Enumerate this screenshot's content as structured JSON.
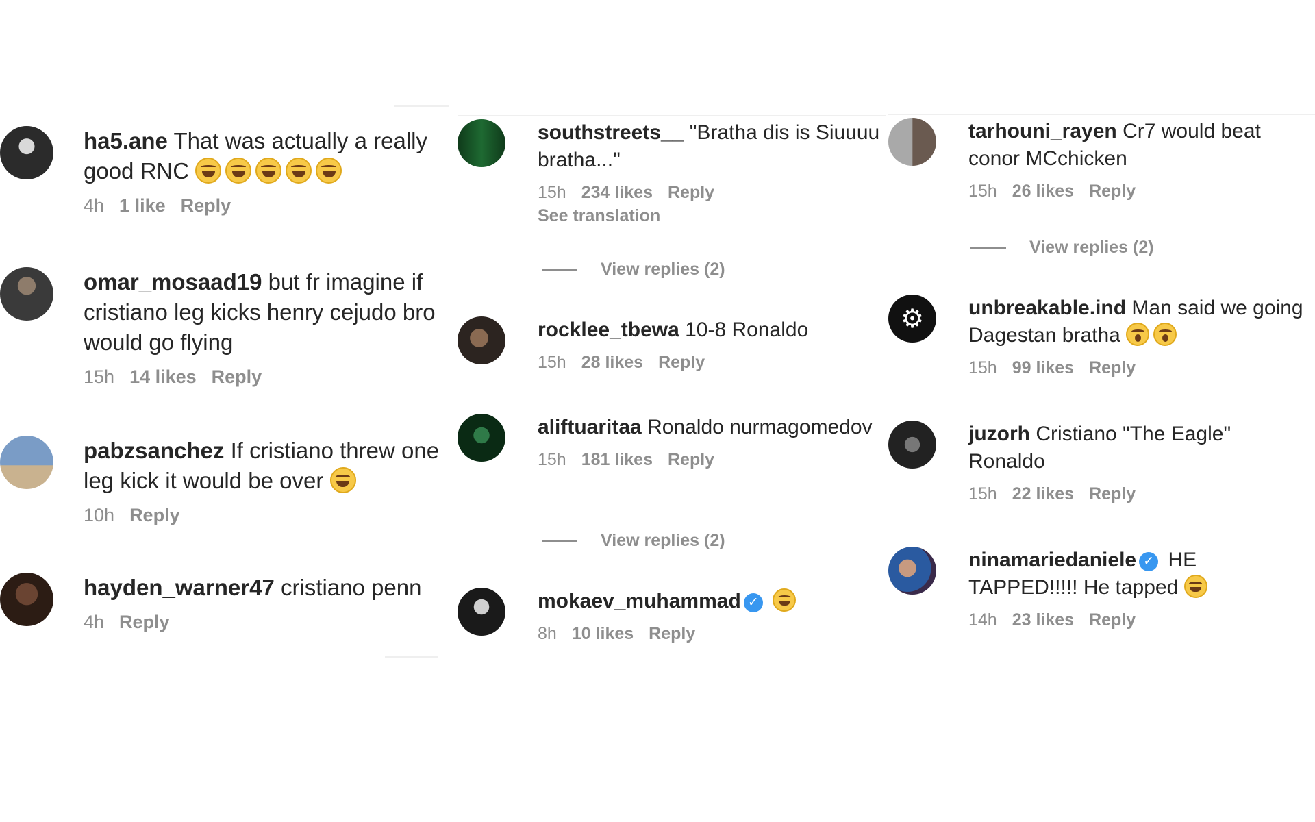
{
  "columns": [
    {
      "comments": [
        {
          "user": "ha5.ane",
          "text": "That was actually a really good RNC",
          "emoji_count": 5,
          "time": "4h",
          "likes": "1 like",
          "reply": "Reply"
        },
        {
          "user": "omar_mosaad19",
          "text": "but fr imagine if cristiano leg kicks henry cejudo bro would go flying",
          "time": "15h",
          "likes": "14 likes",
          "reply": "Reply"
        },
        {
          "user": "pabzsanchez",
          "text": "If cristiano threw one leg kick it would be over",
          "emoji_count": 1,
          "time": "10h",
          "reply": "Reply"
        },
        {
          "user": "hayden_warner47",
          "text": "cristiano penn",
          "time": "4h",
          "reply": "Reply"
        }
      ]
    },
    {
      "comments": [
        {
          "user": "southstreets__",
          "text": "\"Bratha dis is Siuuuu bratha...\"",
          "time": "15h",
          "likes": "234 likes",
          "reply": "Reply",
          "translation": "See translation"
        },
        {
          "user": "rocklee_tbewa",
          "text": "10-8 Ronaldo",
          "time": "15h",
          "likes": "28 likes",
          "reply": "Reply"
        },
        {
          "user": "aliftuaritaa",
          "text": "Ronaldo nurmagomedov",
          "time": "15h",
          "likes": "181 likes",
          "reply": "Reply"
        },
        {
          "user": "mokaev_muhammad",
          "text": "",
          "verified": true,
          "emoji_count": 1,
          "time": "8h",
          "likes": "10 likes",
          "reply": "Reply"
        }
      ],
      "view_replies": [
        "View replies (2)",
        "View replies (2)"
      ]
    },
    {
      "comments": [
        {
          "user": "tarhouni_rayen",
          "text": "Cr7 would beat conor MCchicken",
          "time": "15h",
          "likes": "26 likes",
          "reply": "Reply"
        },
        {
          "user": "unbreakable.ind",
          "text": "Man said we going Dagestan bratha",
          "emoji_count": 2,
          "emoji_kind": "scream",
          "time": "15h",
          "likes": "99 likes",
          "reply": "Reply"
        },
        {
          "user": "juzorh",
          "text": "Cristiano \"The Eagle\" Ronaldo",
          "time": "15h",
          "likes": "22 likes",
          "reply": "Reply"
        },
        {
          "user": "ninamariedaniele",
          "text": "HE TAPPED!!!!! He tapped",
          "verified": true,
          "emoji_count": 1,
          "time": "14h",
          "likes": "23 likes",
          "reply": "Reply"
        }
      ],
      "view_replies": [
        "View replies (2)"
      ]
    }
  ],
  "colors": {
    "text": "#262626",
    "muted": "#8e8e8e",
    "verified": "#3897f0"
  },
  "avatars": [
    [
      "#2b2b2b",
      "#d9d9d9"
    ],
    [
      "#3a3a3a",
      "#8e7c6b"
    ],
    [
      "#7a9cc6",
      "#5a4632"
    ],
    [
      "#4a3226",
      "#2c1c14"
    ],
    [
      "#1e3a1e",
      "#0f5a2a"
    ],
    [
      "#5a4a3a",
      "#2c2420"
    ],
    [
      "#1a4a2a",
      "#0a2a14"
    ],
    [
      "#1a1a1a",
      "#cfcfcf"
    ],
    [
      "#a9a9a9",
      "#4a3a30"
    ],
    [
      "#111111",
      "#ffffff"
    ],
    [
      "#222222",
      "#777777"
    ],
    [
      "#3a2a4a",
      "#2a5aa0"
    ]
  ]
}
